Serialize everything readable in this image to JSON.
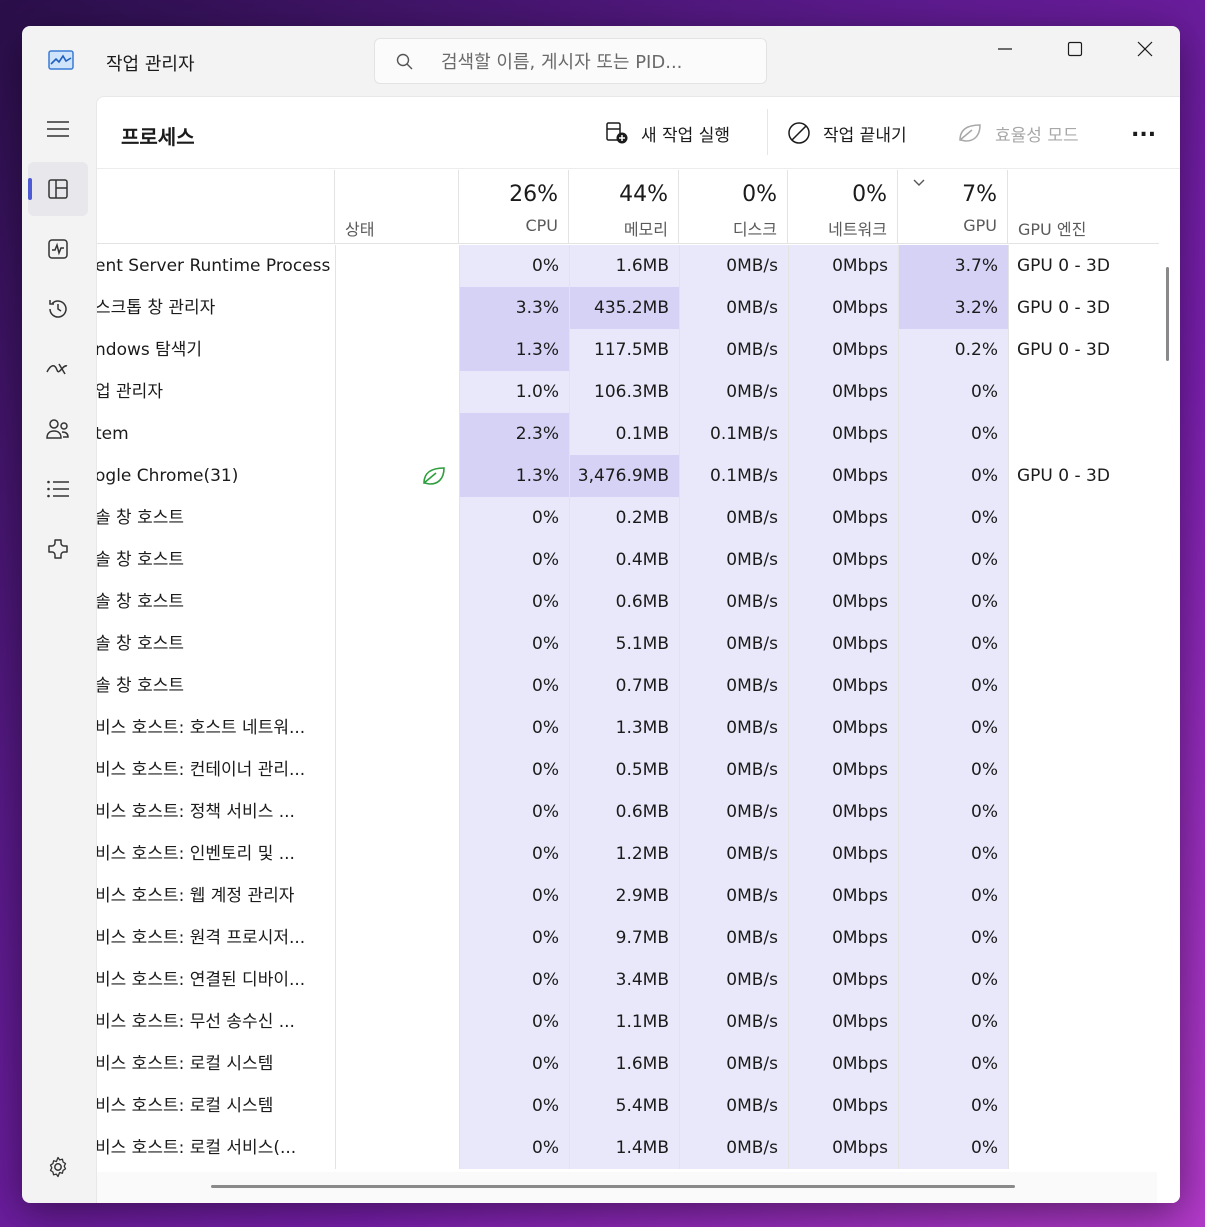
{
  "window": {
    "title": "작업 관리자"
  },
  "search": {
    "placeholder": "검색할 이름, 게시자 또는 PID..."
  },
  "page": {
    "title": "프로세스"
  },
  "commands": {
    "run_new_task": "새 작업 실행",
    "end_task": "작업 끝내기",
    "efficiency_mode": "효율성 모드",
    "more": "..."
  },
  "columns": {
    "status": "상태",
    "cpu": {
      "pct": "26%",
      "label": "CPU"
    },
    "memory": {
      "pct": "44%",
      "label": "메모리"
    },
    "disk": {
      "pct": "0%",
      "label": "디스크"
    },
    "network": {
      "pct": "0%",
      "label": "네트워크"
    },
    "gpu": {
      "pct": "7%",
      "label": "GPU"
    },
    "gpu_engine": "GPU 엔진"
  },
  "nav": [
    "menu-icon",
    "processes-icon",
    "performance-icon",
    "app-history-icon",
    "startup-apps-icon",
    "users-icon",
    "details-icon",
    "services-icon",
    "settings-icon"
  ],
  "colors": {
    "heat_low": "#e9e8fa",
    "heat_mid": "#d6d2f5",
    "accent": "#4f5bd5",
    "leaf": "#2e9e3e"
  },
  "rows": [
    {
      "name": "ent Server Runtime Process",
      "status": "",
      "cpu": "0%",
      "mem": "1.6MB",
      "disk": "0MB/s",
      "net": "0Mbps",
      "gpu": "3.7%",
      "engine": "GPU 0 - 3D"
    },
    {
      "name": "스크톱 창 관리자",
      "status": "",
      "cpu": "3.3%",
      "mem": "435.2MB",
      "disk": "0MB/s",
      "net": "0Mbps",
      "gpu": "3.2%",
      "engine": "GPU 0 - 3D"
    },
    {
      "name": "ndows 탐색기",
      "status": "",
      "cpu": "1.3%",
      "mem": "117.5MB",
      "disk": "0MB/s",
      "net": "0Mbps",
      "gpu": "0.2%",
      "engine": "GPU 0 - 3D"
    },
    {
      "name": "업 관리자",
      "status": "",
      "cpu": "1.0%",
      "mem": "106.3MB",
      "disk": "0MB/s",
      "net": "0Mbps",
      "gpu": "0%",
      "engine": ""
    },
    {
      "name": "tem",
      "status": "",
      "cpu": "2.3%",
      "mem": "0.1MB",
      "disk": "0.1MB/s",
      "net": "0Mbps",
      "gpu": "0%",
      "engine": ""
    },
    {
      "name": "ogle Chrome(31)",
      "status": "leaf",
      "cpu": "1.3%",
      "mem": "3,476.9MB",
      "disk": "0.1MB/s",
      "net": "0Mbps",
      "gpu": "0%",
      "engine": "GPU 0 - 3D"
    },
    {
      "name": "솔 창 호스트",
      "status": "",
      "cpu": "0%",
      "mem": "0.2MB",
      "disk": "0MB/s",
      "net": "0Mbps",
      "gpu": "0%",
      "engine": ""
    },
    {
      "name": "솔 창 호스트",
      "status": "",
      "cpu": "0%",
      "mem": "0.4MB",
      "disk": "0MB/s",
      "net": "0Mbps",
      "gpu": "0%",
      "engine": ""
    },
    {
      "name": "솔 창 호스트",
      "status": "",
      "cpu": "0%",
      "mem": "0.6MB",
      "disk": "0MB/s",
      "net": "0Mbps",
      "gpu": "0%",
      "engine": ""
    },
    {
      "name": "솔 창 호스트",
      "status": "",
      "cpu": "0%",
      "mem": "5.1MB",
      "disk": "0MB/s",
      "net": "0Mbps",
      "gpu": "0%",
      "engine": ""
    },
    {
      "name": "솔 창 호스트",
      "status": "",
      "cpu": "0%",
      "mem": "0.7MB",
      "disk": "0MB/s",
      "net": "0Mbps",
      "gpu": "0%",
      "engine": ""
    },
    {
      "name": "비스 호스트: 호스트 네트워...",
      "status": "",
      "cpu": "0%",
      "mem": "1.3MB",
      "disk": "0MB/s",
      "net": "0Mbps",
      "gpu": "0%",
      "engine": ""
    },
    {
      "name": "비스 호스트: 컨테이너 관리...",
      "status": "",
      "cpu": "0%",
      "mem": "0.5MB",
      "disk": "0MB/s",
      "net": "0Mbps",
      "gpu": "0%",
      "engine": ""
    },
    {
      "name": "비스 호스트: 정책 서비스 ...",
      "status": "",
      "cpu": "0%",
      "mem": "0.6MB",
      "disk": "0MB/s",
      "net": "0Mbps",
      "gpu": "0%",
      "engine": ""
    },
    {
      "name": "비스 호스트: 인벤토리 및 ...",
      "status": "",
      "cpu": "0%",
      "mem": "1.2MB",
      "disk": "0MB/s",
      "net": "0Mbps",
      "gpu": "0%",
      "engine": ""
    },
    {
      "name": "비스 호스트: 웹 계정 관리자",
      "status": "",
      "cpu": "0%",
      "mem": "2.9MB",
      "disk": "0MB/s",
      "net": "0Mbps",
      "gpu": "0%",
      "engine": ""
    },
    {
      "name": "비스 호스트: 원격 프로시저...",
      "status": "",
      "cpu": "0%",
      "mem": "9.7MB",
      "disk": "0MB/s",
      "net": "0Mbps",
      "gpu": "0%",
      "engine": ""
    },
    {
      "name": "비스 호스트: 연결된 디바이...",
      "status": "",
      "cpu": "0%",
      "mem": "3.4MB",
      "disk": "0MB/s",
      "net": "0Mbps",
      "gpu": "0%",
      "engine": ""
    },
    {
      "name": "비스 호스트: 무선 송수신 ...",
      "status": "",
      "cpu": "0%",
      "mem": "1.1MB",
      "disk": "0MB/s",
      "net": "0Mbps",
      "gpu": "0%",
      "engine": ""
    },
    {
      "name": "비스 호스트: 로컬 시스템",
      "status": "",
      "cpu": "0%",
      "mem": "1.6MB",
      "disk": "0MB/s",
      "net": "0Mbps",
      "gpu": "0%",
      "engine": ""
    },
    {
      "name": "비스 호스트: 로컬 시스템",
      "status": "",
      "cpu": "0%",
      "mem": "5.4MB",
      "disk": "0MB/s",
      "net": "0Mbps",
      "gpu": "0%",
      "engine": ""
    },
    {
      "name": "비스 호스트: 로컬 서비스(...",
      "status": "",
      "cpu": "0%",
      "mem": "1.4MB",
      "disk": "0MB/s",
      "net": "0Mbps",
      "gpu": "0%",
      "engine": ""
    }
  ]
}
